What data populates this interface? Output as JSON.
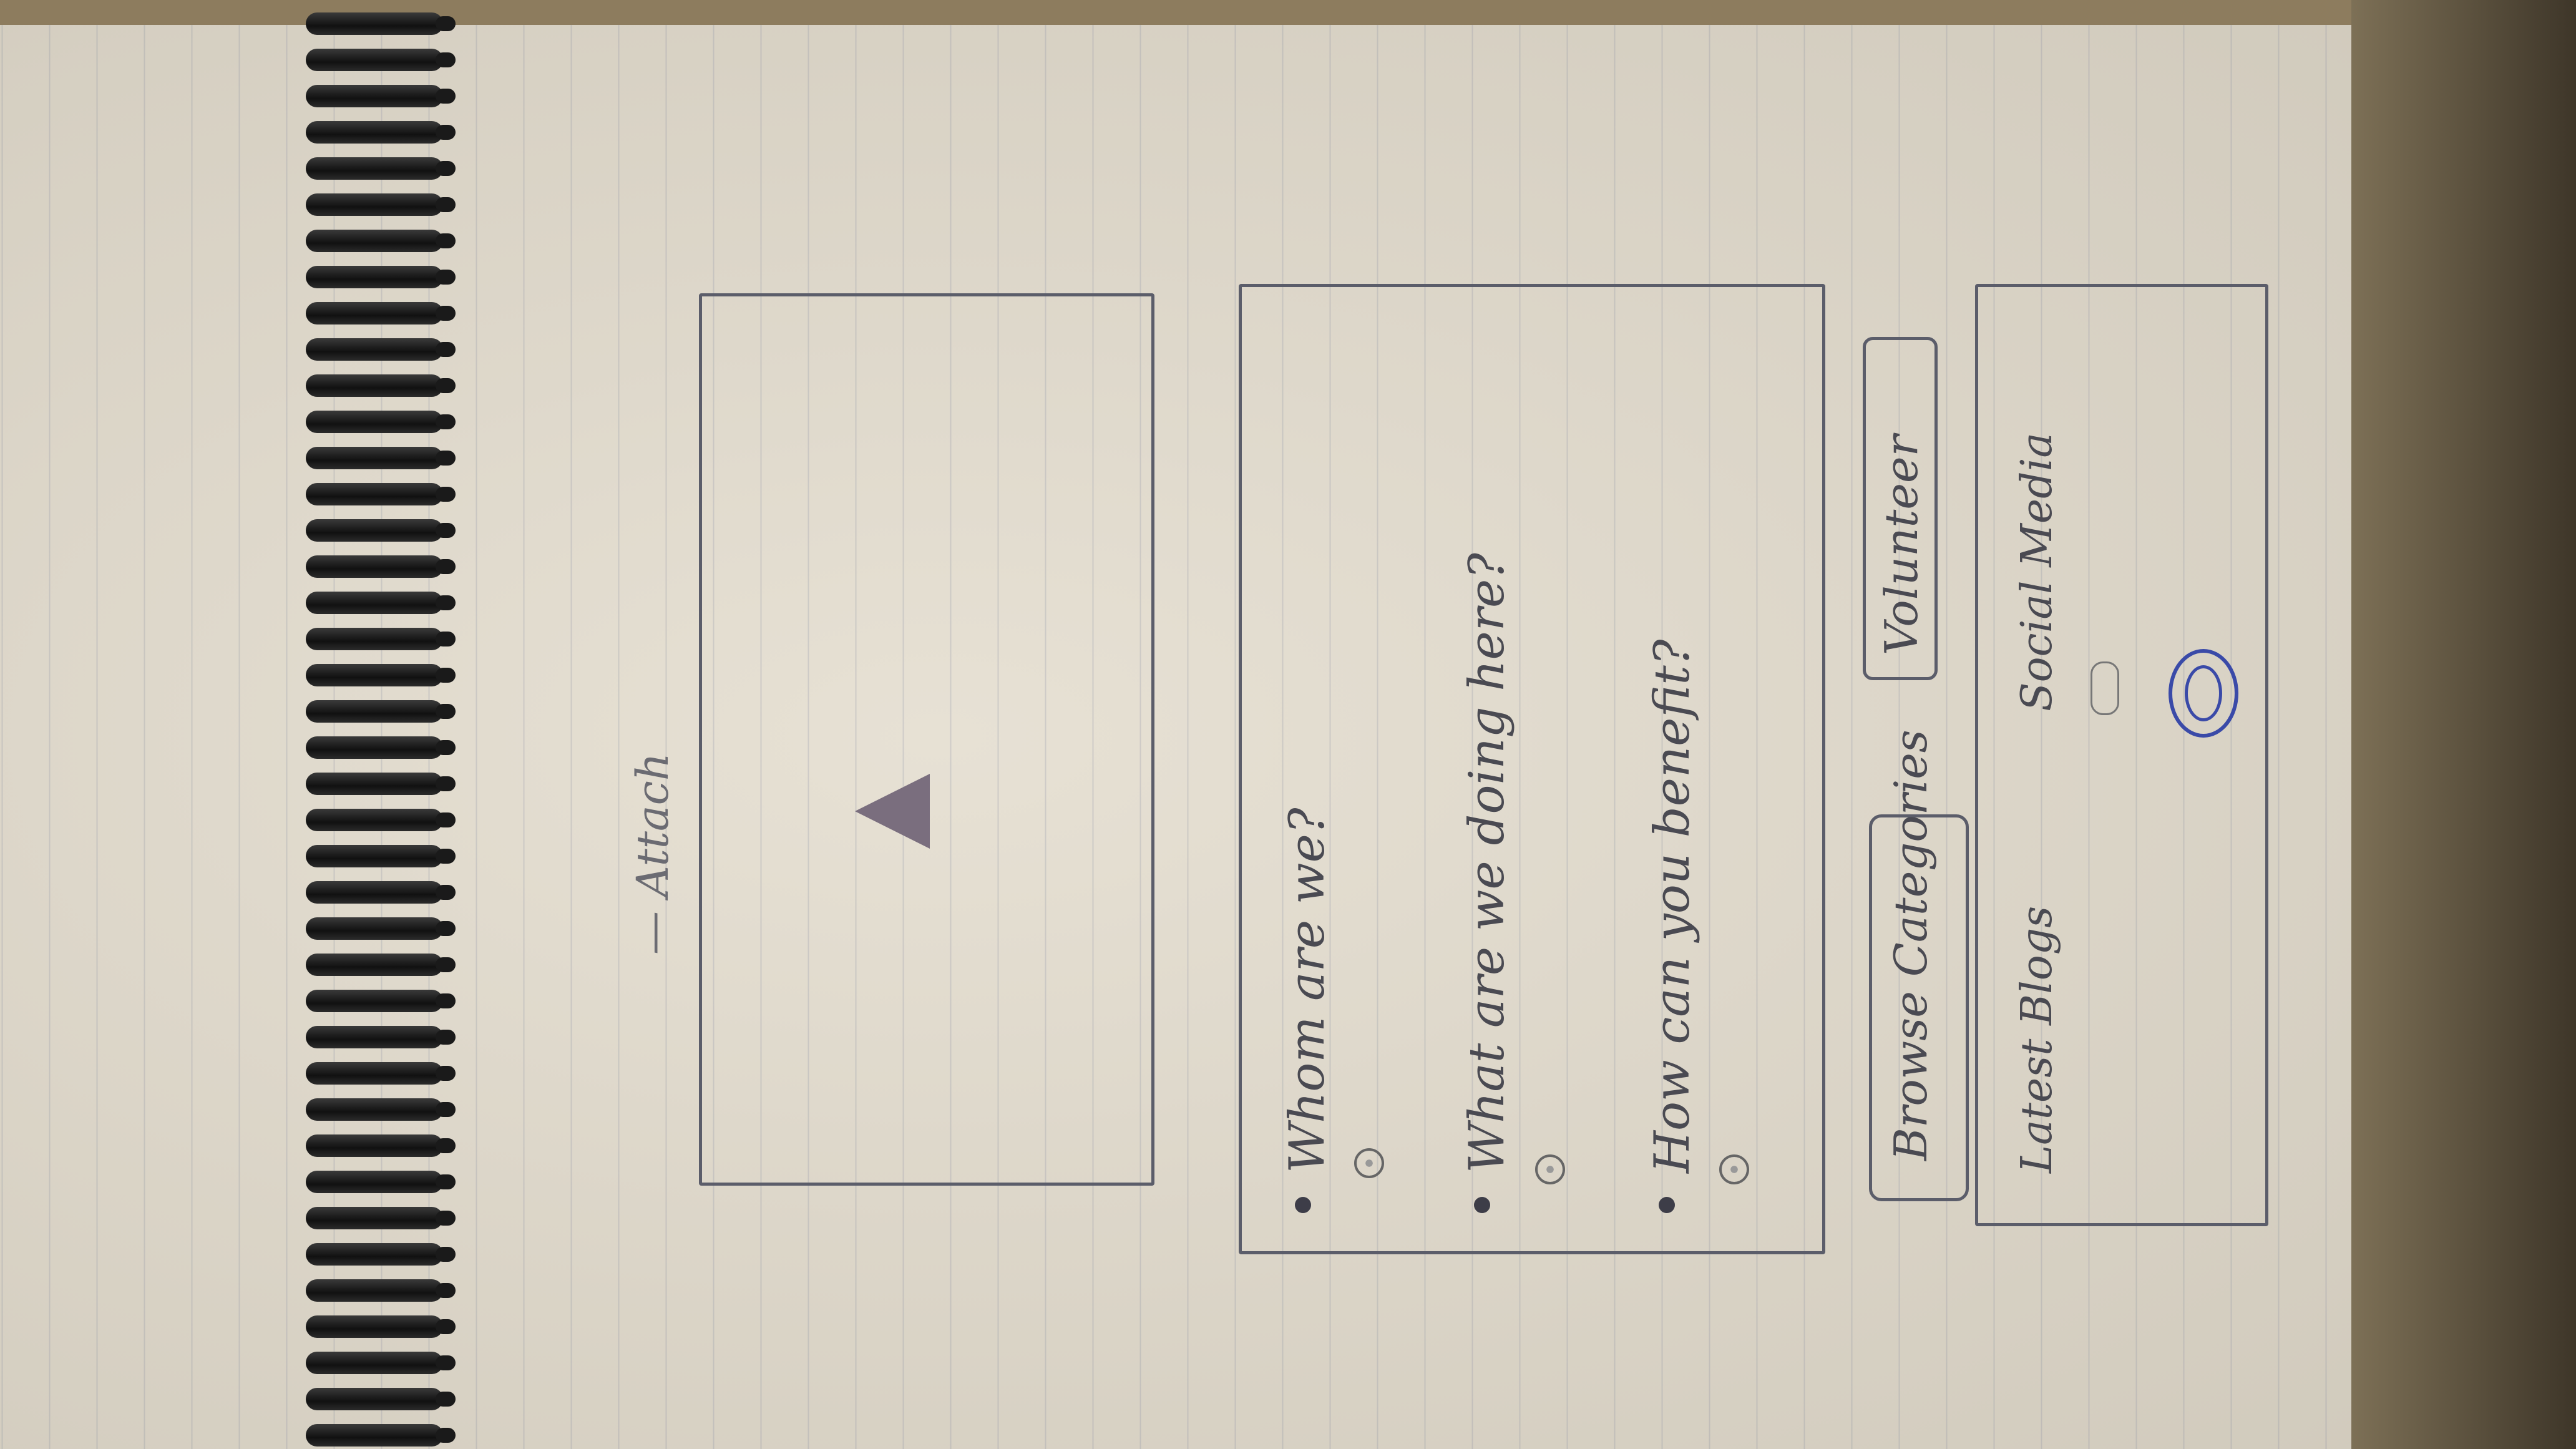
{
  "sketch": {
    "header_label": "— Attach",
    "upload_area": {
      "icon": "triangle-icon"
    },
    "info_box": {
      "lines": [
        {
          "text": "Whom are we?"
        },
        {
          "text": "What are we doing here?"
        },
        {
          "text": "How can you benefit?"
        }
      ]
    },
    "buttons": {
      "left": "Browse Categories",
      "right": "Volunteer"
    },
    "footer_box": {
      "left_label": "Latest Blogs",
      "right_label": "Social Media",
      "social_icon": "social-media-icon"
    }
  }
}
